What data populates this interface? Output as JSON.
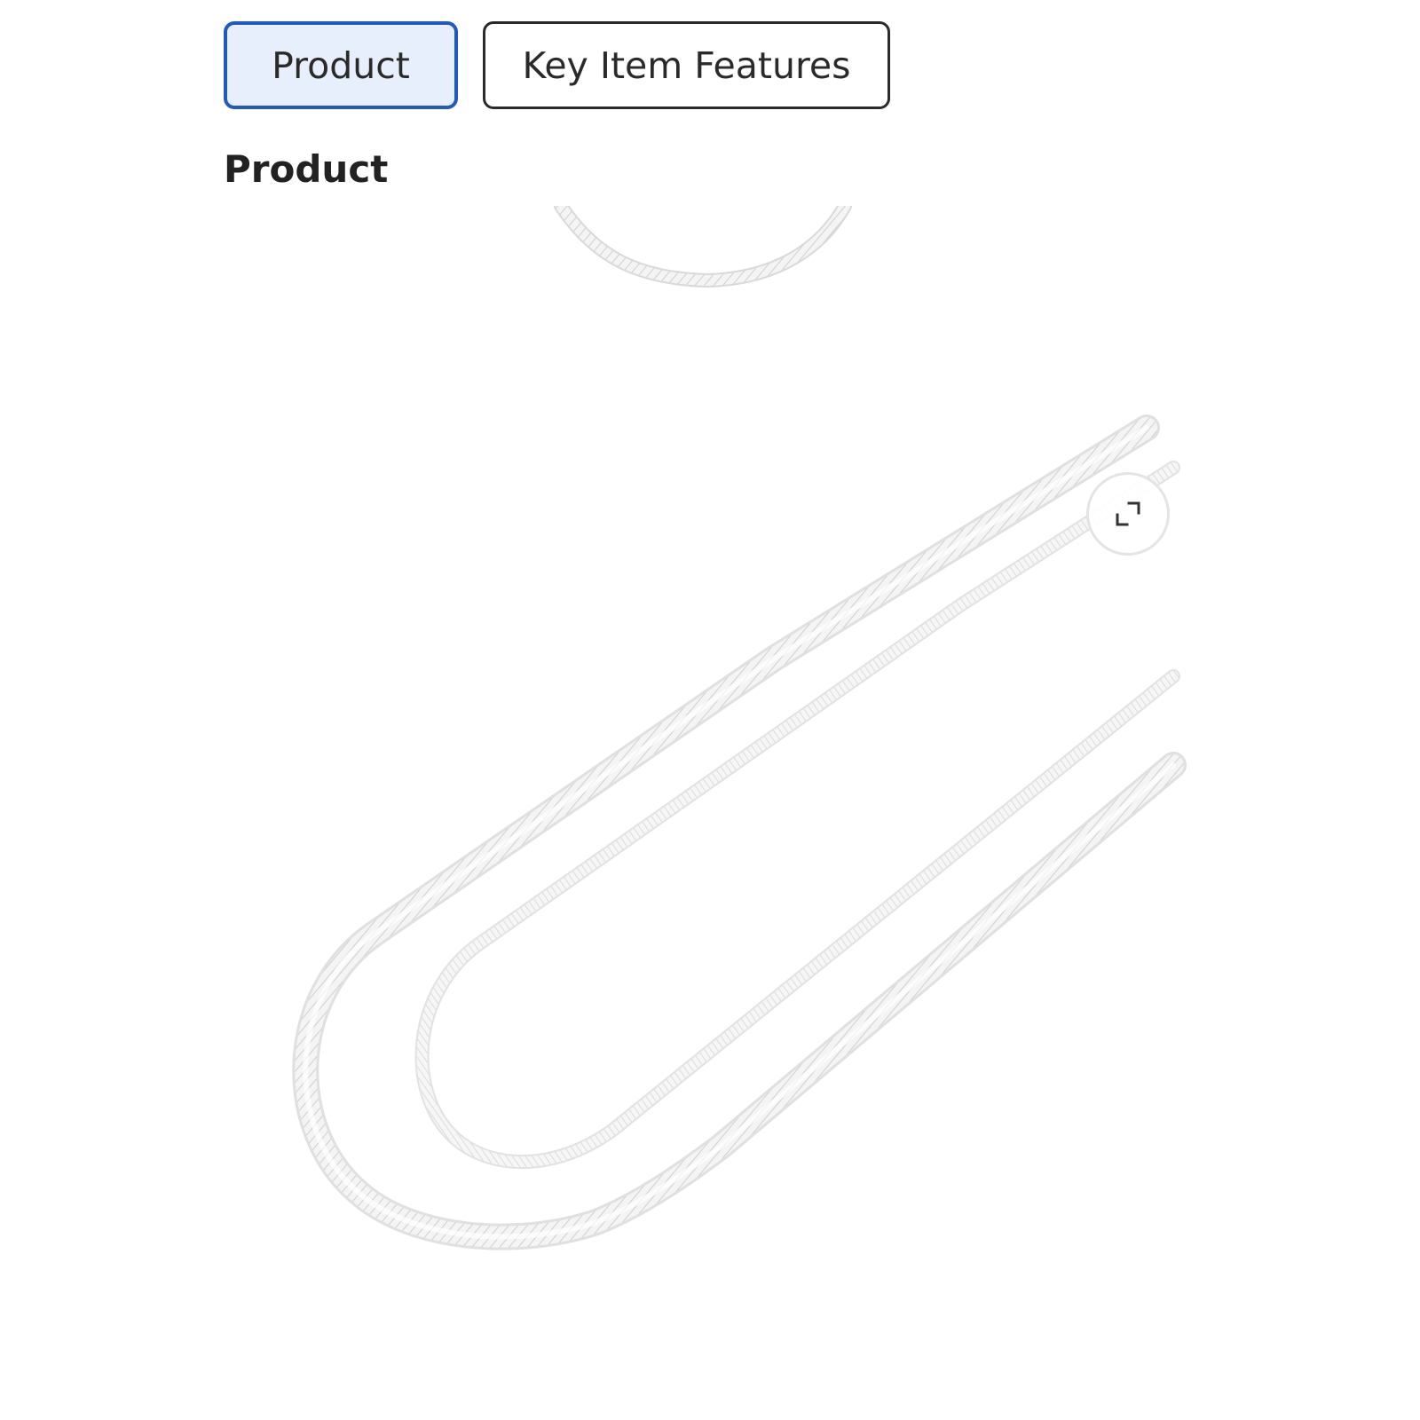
{
  "tabs": [
    {
      "label": "Product",
      "active": true
    },
    {
      "label": "Key Item Features",
      "active": false
    }
  ],
  "section": {
    "title": "Product"
  },
  "product_image": {
    "subject": "silver herringbone chain necklace"
  },
  "expand_button": {
    "icon": "expand-icon"
  },
  "colors": {
    "accent": "#1f5bbf",
    "active_tab_bg": "#e6effb",
    "text": "#222222"
  }
}
